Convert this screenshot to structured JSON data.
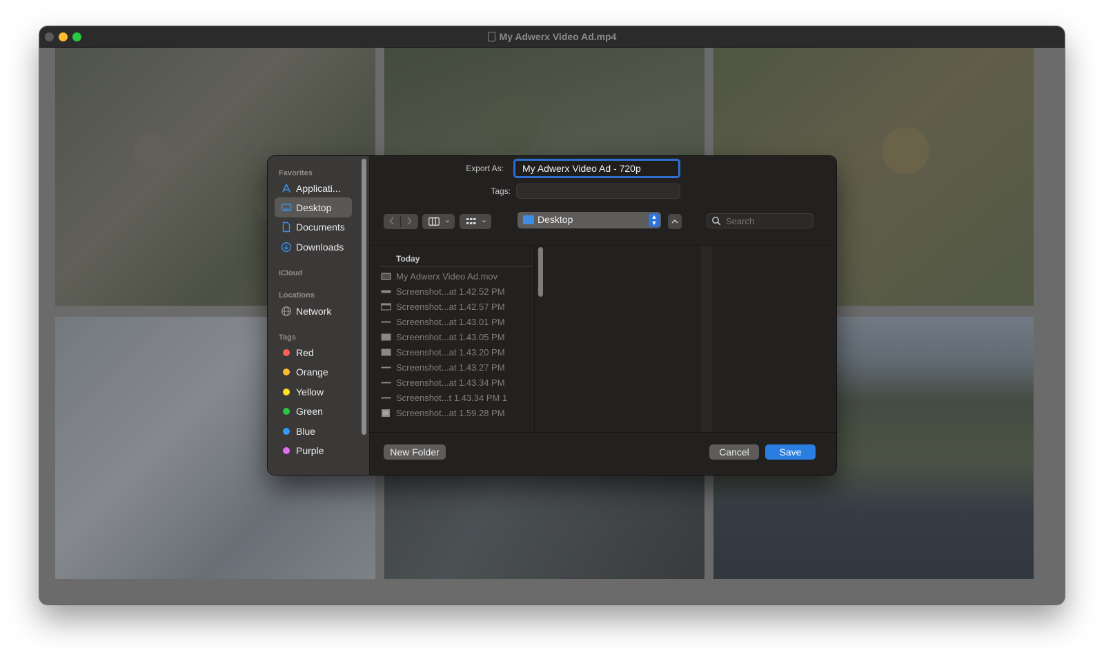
{
  "window": {
    "title": "My Adwerx Video Ad.mp4"
  },
  "sidebar": {
    "favorites_header": "Favorites",
    "favorites": [
      {
        "label": "Applicati...",
        "icon": "applications-icon"
      },
      {
        "label": "Desktop",
        "icon": "desktop-icon",
        "selected": true
      },
      {
        "label": "Documents",
        "icon": "documents-icon"
      },
      {
        "label": "Downloads",
        "icon": "downloads-icon"
      }
    ],
    "icloud_header": "iCloud",
    "locations_header": "Locations",
    "locations": [
      {
        "label": "Network",
        "icon": "network-icon"
      }
    ],
    "tags_header": "Tags",
    "tags": [
      {
        "label": "Red",
        "color": "#ff5f57"
      },
      {
        "label": "Orange",
        "color": "#febc2e"
      },
      {
        "label": "Yellow",
        "color": "#ffe21a"
      },
      {
        "label": "Green",
        "color": "#28c840"
      },
      {
        "label": "Blue",
        "color": "#2f9bff"
      },
      {
        "label": "Purple",
        "color": "#e46cf0"
      }
    ]
  },
  "form": {
    "export_as_label": "Export As:",
    "export_as_value": "My Adwerx Video Ad - 720p",
    "tags_label": "Tags:",
    "tags_value": ""
  },
  "toolbar": {
    "location": "Desktop",
    "search_placeholder": "Search"
  },
  "browser": {
    "group_header": "Today",
    "files": [
      {
        "name": "My Adwerx Video Ad.mov",
        "icon": "video-file-icon"
      },
      {
        "name": "Screenshot...at 1.42.52 PM",
        "icon": "image-file-icon"
      },
      {
        "name": "Screenshot...at 1.42.57 PM",
        "icon": "image-file-icon"
      },
      {
        "name": "Screenshot...at 1.43.01 PM",
        "icon": "image-file-icon"
      },
      {
        "name": "Screenshot...at 1.43.05 PM",
        "icon": "image-file-icon"
      },
      {
        "name": "Screenshot...at 1.43.20 PM",
        "icon": "image-file-icon"
      },
      {
        "name": "Screenshot...at 1.43.27 PM",
        "icon": "image-file-icon"
      },
      {
        "name": "Screenshot...at 1.43.34 PM",
        "icon": "image-file-icon"
      },
      {
        "name": "Screenshot...t 1.43.34 PM 1",
        "icon": "image-file-icon"
      },
      {
        "name": "Screenshot...at 1.59.28 PM",
        "icon": "image-file-icon"
      }
    ]
  },
  "buttons": {
    "new_folder": "New Folder",
    "cancel": "Cancel",
    "save": "Save"
  },
  "colors": {
    "accent": "#2a7de1",
    "dialog_bg": "#232120",
    "sidebar_bg": "#3b3938"
  }
}
